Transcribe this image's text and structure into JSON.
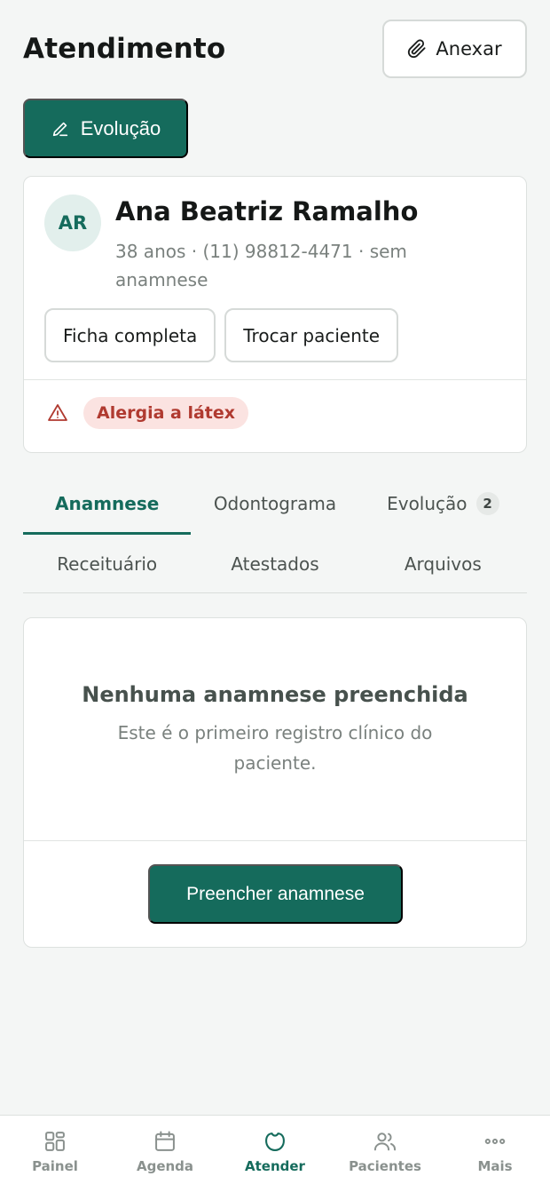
{
  "header": {
    "title": "Atendimento",
    "attach_label": "Anexar"
  },
  "evolution_button": {
    "label": "Evolução"
  },
  "patient": {
    "initials": "AR",
    "name": "Ana Beatriz Ramalho",
    "meta": "38 anos · (11) 98812-4471 · sem anamnese",
    "actions": {
      "full_record": "Ficha completa",
      "switch_patient": "Trocar paciente"
    },
    "allergy": "Alergia a látex"
  },
  "tabs": {
    "row1": [
      {
        "label": "Anamnese",
        "active": true
      },
      {
        "label": "Odontograma"
      },
      {
        "label": "Evolução",
        "count": "2"
      }
    ],
    "row2": [
      {
        "label": "Receituário"
      },
      {
        "label": "Atestados"
      },
      {
        "label": "Arquivos"
      }
    ]
  },
  "empty_state": {
    "title": "Nenhuma anamnese preenchida",
    "description": "Este é o primeiro registro clínico do paciente.",
    "cta": "Preencher anamnese"
  },
  "bottom_nav": [
    {
      "label": "Painel",
      "icon": "grid-icon"
    },
    {
      "label": "Agenda",
      "icon": "calendar-icon"
    },
    {
      "label": "Atender",
      "icon": "tooth-icon",
      "active": true
    },
    {
      "label": "Pacientes",
      "icon": "users-icon"
    },
    {
      "label": "Mais",
      "icon": "more-dots-icon"
    }
  ],
  "colors": {
    "primary": "#156b5c",
    "background": "#f4f6f5",
    "alert_bg": "#fbe3e1",
    "alert_text": "#b03a30"
  }
}
